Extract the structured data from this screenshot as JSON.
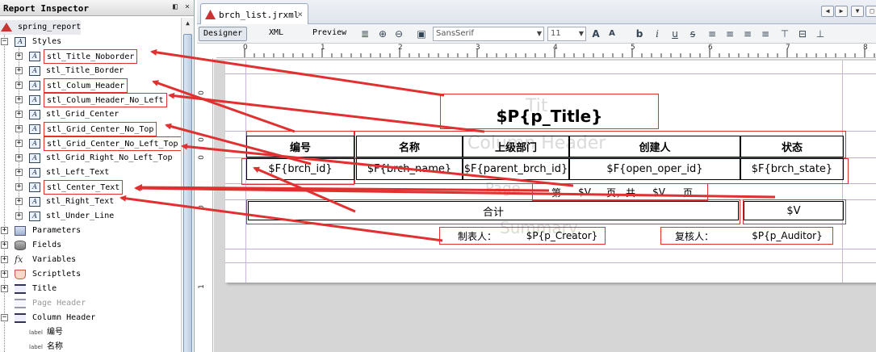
{
  "inspector": {
    "title": "Report Inspector",
    "root": "spring_report",
    "styles_label": "Styles",
    "styles": [
      "stl_Title_Noborder",
      "stl_Title_Border",
      "stl_Colum_Header",
      "stl_Colum_Header_No_Left",
      "stl_Grid_Center",
      "stl_Grid_Center_No_Top",
      "stl_Grid_Center_No_Left_Top",
      "stl_Grid_Right_No_Left_Top",
      "stl_Left_Text",
      "stl_Center_Text",
      "stl_Right_Text",
      "stl_Under_Line"
    ],
    "nodes": {
      "parameters": "Parameters",
      "fields": "Fields",
      "variables": "Variables",
      "scriptlets": "Scriptlets",
      "title": "Title",
      "page_header": "Page Header",
      "column_header": "Column Header",
      "col_label_1": "编号",
      "col_label_2": "名称"
    },
    "label_tag": "label",
    "header_buttons": [
      "◧",
      "×"
    ]
  },
  "editor": {
    "tab_title": "brch_list.jrxml",
    "tab_close": "×",
    "modes": {
      "designer": "Designer",
      "xml": "XML",
      "preview": "Preview"
    },
    "font_family": "SansSerif",
    "font_size": "11",
    "ruler_marks": [
      "0",
      "1",
      "2",
      "3",
      "4",
      "5",
      "6",
      "7",
      "8"
    ],
    "vruler_marks": [
      "0",
      "0",
      "0",
      "0",
      "1"
    ]
  },
  "report": {
    "title_text": "$P{p_Title}",
    "ghost_title": "Tit",
    "ghost_column_header": "Column Header",
    "ghost_page": "Page",
    "ghost_summary": "Summary",
    "headers": [
      "编号",
      "名称",
      "上级部门",
      "创建人",
      "状态"
    ],
    "fields": [
      "$F{brch_id}",
      "$F{brch_name}",
      "$F{parent_brch_id}",
      "$F{open_oper_id}",
      "$F{brch_state}"
    ],
    "page_footer": [
      "第",
      "$V",
      "页，共",
      "$V",
      "页"
    ],
    "total_label": "合计",
    "total_value": "$V",
    "creator_label": "制表人：",
    "creator_value": "$P{p_Creator}",
    "auditor_label": "复核人：",
    "auditor_value": "$P{p_Auditor}"
  },
  "colors": {
    "annotation": "#e03030",
    "band_line": "#c0b0d8"
  }
}
